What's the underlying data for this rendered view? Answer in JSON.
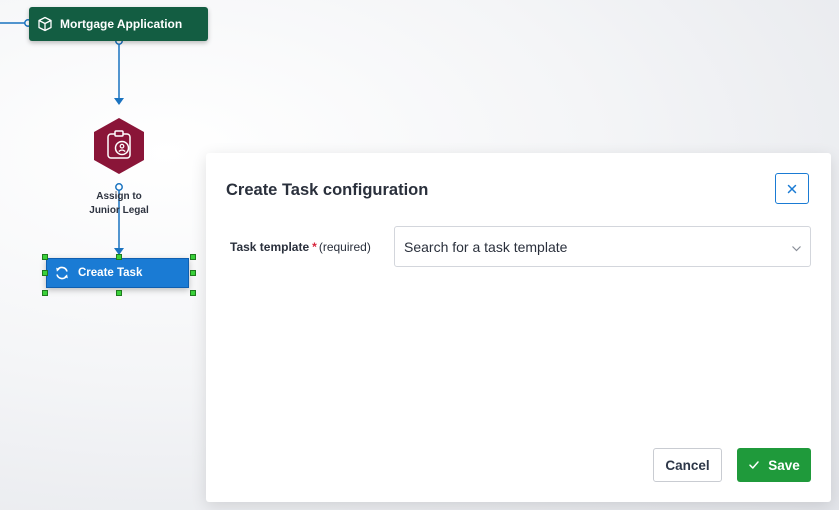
{
  "flow": {
    "nodes": {
      "mortgage": {
        "label": "Mortgage Application",
        "icon": "cube-icon",
        "color": "#135d42"
      },
      "assign": {
        "label_line1": "Assign to",
        "label_line2": "Junior Legal",
        "icon": "badge-user-icon",
        "color": "#8a1538"
      },
      "create_task": {
        "label": "Create Task",
        "icon": "refresh-icon",
        "color": "#1a7bd4",
        "selected": true
      }
    },
    "connector_color": "#1a73c0"
  },
  "panel": {
    "title": "Create Task configuration",
    "close_icon": "close-icon",
    "field": {
      "label": "Task template",
      "required_mark": "*",
      "required_text": "(required)",
      "placeholder": "Search for a task template"
    },
    "buttons": {
      "cancel": "Cancel",
      "save": "Save"
    },
    "accent": "#1a7bd4",
    "save_color": "#1f9a3b"
  }
}
